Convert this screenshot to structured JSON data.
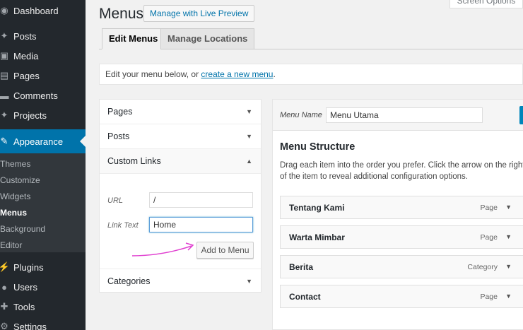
{
  "sidebar": {
    "items": [
      {
        "label": "Dashboard",
        "icon": "dashboard-icon",
        "glyph": "◉"
      },
      {
        "label": "Posts",
        "icon": "pin-icon",
        "glyph": "📌"
      },
      {
        "label": "Media",
        "icon": "media-icon",
        "glyph": "▣"
      },
      {
        "label": "Pages",
        "icon": "page-icon",
        "glyph": "▤"
      },
      {
        "label": "Comments",
        "icon": "comment-icon",
        "glyph": "▬"
      },
      {
        "label": "Projects",
        "icon": "pin-icon",
        "glyph": "📌"
      },
      {
        "label": "Appearance",
        "icon": "brush-icon",
        "glyph": "✎"
      },
      {
        "label": "Plugins",
        "icon": "plugin-icon",
        "glyph": "⚡"
      },
      {
        "label": "Users",
        "icon": "users-icon",
        "glyph": "👤"
      },
      {
        "label": "Tools",
        "icon": "wrench-icon",
        "glyph": "🔧"
      },
      {
        "label": "Settings",
        "icon": "settings-icon",
        "glyph": "⚙"
      }
    ],
    "submenu": [
      "Themes",
      "Customize",
      "Widgets",
      "Menus",
      "Background",
      "Editor"
    ]
  },
  "header": {
    "title": "Menus",
    "preview_button": "Manage with Live Preview",
    "screen_options": "Screen Options"
  },
  "tabs": [
    "Edit Menus",
    "Manage Locations"
  ],
  "notice": {
    "text": "Edit your menu below, or ",
    "link": "create a new menu",
    "end": "."
  },
  "accordion": {
    "pages": "Pages",
    "posts": "Posts",
    "custom_links": "Custom Links",
    "url_label": "URL",
    "url_value": "/",
    "link_text_label": "Link Text",
    "link_text_value": "Home",
    "add_button": "Add to Menu",
    "categories": "Categories"
  },
  "menu": {
    "name_label": "Menu Name",
    "name_value": "Menu Utama",
    "structure_title": "Menu Structure",
    "structure_desc": "Drag each item into the order you prefer. Click the arrow on the right of the item to reveal additional configuration options.",
    "items": [
      {
        "title": "Tentang Kami",
        "type": "Page"
      },
      {
        "title": "Warta Mimbar",
        "type": "Page"
      },
      {
        "title": "Berita",
        "type": "Category"
      },
      {
        "title": "Contact",
        "type": "Page"
      }
    ]
  },
  "colors": {
    "sidebar_bg": "#23282d",
    "active": "#0073aa",
    "annotation": "#e040d0"
  }
}
